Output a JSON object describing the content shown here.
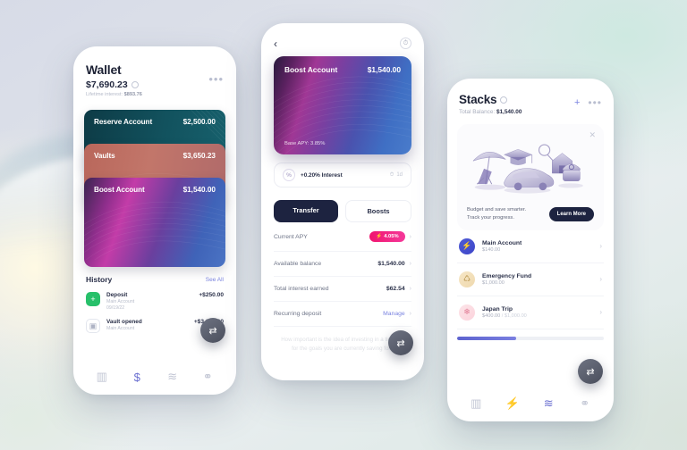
{
  "background": {
    "base_color": "#dfe2ea",
    "accent_mint": "#cde9e0",
    "accent_cream": "#fffae4"
  },
  "phone1": {
    "title": "Wallet",
    "balance": "$7,690.23",
    "lifetime_label": "Lifetime interest:",
    "lifetime_value": "$893.76",
    "menu_icon": "ellipsis-icon",
    "info_icon": "info-icon",
    "cards": [
      {
        "name": "Reserve Account",
        "value": "$2,500.00",
        "color": "#12525e"
      },
      {
        "name": "Vaults",
        "value": "$3,650.23",
        "color": "#bd6f63"
      },
      {
        "name": "Boost Account",
        "value": "$1,540.00",
        "color": "#8b3fa5"
      }
    ],
    "history": {
      "title": "History",
      "see_all": "See All",
      "items": [
        {
          "icon": "plus-icon",
          "name": "Deposit",
          "account": "Main Account",
          "date": "09/19/22",
          "amount": "+$250.00"
        },
        {
          "icon": "vault-icon",
          "name": "Vault opened",
          "account": "Main Account",
          "date": "",
          "amount": "+$3,000.00"
        }
      ]
    },
    "fab_icon": "transfer-icon",
    "nav": [
      {
        "icon": "card-icon",
        "active": false
      },
      {
        "icon": "dollar-icon",
        "active": true
      },
      {
        "icon": "stacks-icon",
        "active": false
      },
      {
        "icon": "person-icon",
        "active": false
      }
    ]
  },
  "phone2": {
    "back_icon": "chevron-left-icon",
    "clock_icon": "history-clock-icon",
    "card": {
      "name": "Boost Account",
      "value": "$1,540.00",
      "apy_label": "Base APY: 3.85%"
    },
    "interest_row": {
      "icon": "percent-icon",
      "text": "+0.20% Interest",
      "right_icon": "clock-icon",
      "right_text": "1d"
    },
    "tabs": [
      {
        "label": "Transfer",
        "active": true
      },
      {
        "label": "Boosts",
        "active": false
      }
    ],
    "rows": [
      {
        "key": "Current APY",
        "value": "4.05%",
        "type": "badge"
      },
      {
        "key": "Available balance",
        "value": "$1,540.00",
        "type": "text"
      },
      {
        "key": "Total interest earned",
        "value": "$62.54",
        "type": "text"
      },
      {
        "key": "Recurring deposit",
        "value": "Manage",
        "type": "link"
      }
    ],
    "faded_text": "How important is the idea of investing in a timeline for the goals you are currently saving for?",
    "fab_icon": "transfer-icon"
  },
  "phone3": {
    "title": "Stacks",
    "info_icon": "info-icon",
    "add_icon": "plus-icon",
    "menu_icon": "ellipsis-icon",
    "balance_label": "Total Balance:",
    "balance_value": "$1,540.00",
    "promo": {
      "close_icon": "close-icon",
      "line1": "Budget and save smarter.",
      "line2": "Track your progress.",
      "button": "Learn More",
      "art_items": [
        "beach-umbrella-icon",
        "graduation-cap-icon",
        "house-key-icon",
        "car-icon",
        "ring-box-icon"
      ]
    },
    "stacks": [
      {
        "icon": "bolt-icon",
        "name": "Main Account",
        "value": "$140.00",
        "goal": ""
      },
      {
        "icon": "piggy-icon",
        "name": "Emergency Fund",
        "value": "$1,000.00",
        "goal": ""
      },
      {
        "icon": "flower-icon",
        "name": "Japan Trip",
        "value": "$400.00",
        "goal": "/ $1,000.00"
      }
    ],
    "progress_percent": 40,
    "fab_icon": "transfer-icon",
    "nav": [
      {
        "icon": "card-icon",
        "active": false
      },
      {
        "icon": "bolt-icon",
        "active": false
      },
      {
        "icon": "stacks-icon",
        "active": true
      },
      {
        "icon": "person-icon",
        "active": false
      }
    ]
  }
}
